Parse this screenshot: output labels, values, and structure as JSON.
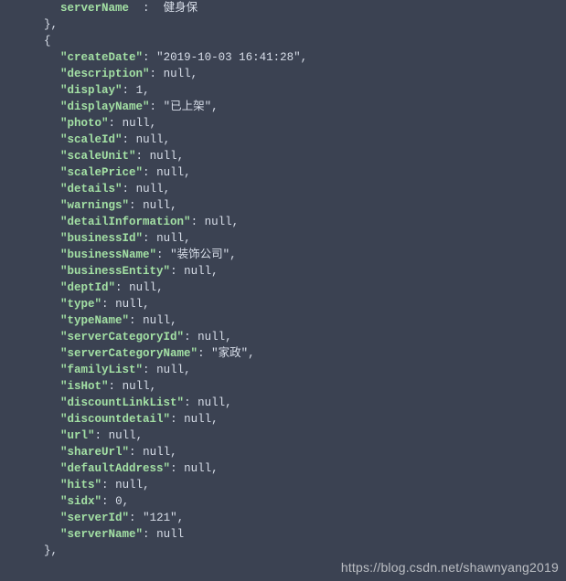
{
  "partial_top": {
    "line1_key_fragment": "serverName",
    "line1_value_fragment": "健身保"
  },
  "object": {
    "createDate": "2019-10-03 16:41:28",
    "description": null,
    "display": 1,
    "displayName": "已上架",
    "photo": null,
    "scaleId": null,
    "scaleUnit": null,
    "scalePrice": null,
    "details": null,
    "warnings": null,
    "detailInformation": null,
    "businessId": null,
    "businessName": "装饰公司",
    "businessEntity": null,
    "deptId": null,
    "type": null,
    "typeName": null,
    "serverCategoryId": null,
    "serverCategoryName": "家政",
    "familyList": null,
    "isHot": null,
    "discountLinkList": null,
    "discountdetail": null,
    "url": null,
    "shareUrl": null,
    "defaultAddress": null,
    "hits": null,
    "sidx": 0,
    "serverId": "121",
    "serverName": null
  },
  "labels": {
    "createDate": "createDate",
    "description": "description",
    "display": "display",
    "displayName": "displayName",
    "photo": "photo",
    "scaleId": "scaleId",
    "scaleUnit": "scaleUnit",
    "scalePrice": "scalePrice",
    "details": "details",
    "warnings": "warnings",
    "detailInformation": "detailInformation",
    "businessId": "businessId",
    "businessName": "businessName",
    "businessEntity": "businessEntity",
    "deptId": "deptId",
    "type": "type",
    "typeName": "typeName",
    "serverCategoryId": "serverCategoryId",
    "serverCategoryName": "serverCategoryName",
    "familyList": "familyList",
    "isHot": "isHot",
    "discountLinkList": "discountLinkList",
    "discountdetail": "discountdetail",
    "url": "url",
    "shareUrl": "shareUrl",
    "defaultAddress": "defaultAddress",
    "hits": "hits",
    "sidx": "sidx",
    "serverId": "serverId",
    "serverName": "serverName"
  },
  "watermark": "https://blog.csdn.net/shawnyang2019",
  "null_text": "null"
}
